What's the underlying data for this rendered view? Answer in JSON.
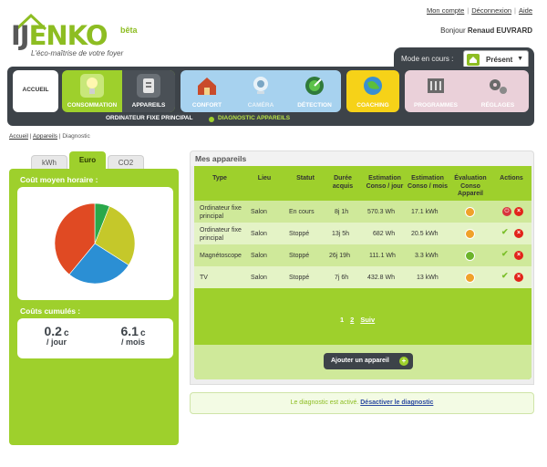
{
  "brand": {
    "name_pre": "IJ",
    "name_post": "ENKO",
    "beta": "bêta",
    "tagline": "L'éco-maîtrise de votre foyer"
  },
  "toplinks": {
    "account": "Mon compte",
    "logout": "Déconnexion",
    "help": "Aide"
  },
  "greeting": {
    "prefix": "Bonjour",
    "user": "Renaud EUVRARD"
  },
  "mode": {
    "label": "Mode en cours :",
    "value": "Présent"
  },
  "nav": {
    "accueil": "ACCUEIL",
    "consommation": "CONSOMMATION",
    "appareils": "APPAREILS",
    "confort": "CONFORT",
    "camera": "CAMÉRA",
    "detection": "DÉTECTION",
    "coaching": "COACHING",
    "programmes": "PROGRAMMES",
    "reglages": "RÉGLAGES"
  },
  "subnav": {
    "item1": "ORDINATEUR FIXE PRINCIPAL",
    "item2": "DIAGNOSTIC APPAREILS"
  },
  "breadcrumb": {
    "home": "Accueil",
    "devices": "Appareils",
    "current": "Diagnostic"
  },
  "left": {
    "tabs": [
      "kWh",
      "Euro",
      "CO2"
    ],
    "hourly_title": "Coût moyen horaire :",
    "cumul_title": "Coûts cumulés :",
    "per_day": {
      "value": "0.2",
      "unit": "c",
      "period": "/ jour"
    },
    "per_month": {
      "value": "6.1",
      "unit": "c",
      "period": "/ mois"
    }
  },
  "pie": {
    "slices": [
      {
        "name": "green",
        "value": 6,
        "color": "#2aa84a"
      },
      {
        "name": "yellow",
        "value": 28,
        "color": "#c5c82a"
      },
      {
        "name": "blue",
        "value": 27,
        "color": "#2b8fd4"
      },
      {
        "name": "red",
        "value": 39,
        "color": "#e04a23"
      }
    ]
  },
  "devices": {
    "title": "Mes appareils",
    "headers": {
      "type": "Type",
      "lieu": "Lieu",
      "statut": "Statut",
      "duree": "Durée acquis",
      "conso_jour": "Estimation Conso / jour",
      "conso_mois": "Estimation Conso / mois",
      "evaluation": "Évaluation Conso Appareil",
      "actions": "Actions"
    },
    "rows": [
      {
        "type": "Ordinateur fixe principal",
        "lieu": "Salon",
        "statut": "En cours",
        "duree": "8j 1h",
        "jour": "570.3 Wh",
        "mois": "17.1 kWh",
        "eval_color": "#f0a12a"
      },
      {
        "type": "Ordinateur fixe principal",
        "lieu": "Salon",
        "statut": "Stoppé",
        "duree": "13j 5h",
        "jour": "682 Wh",
        "mois": "20.5 kWh",
        "eval_color": "#f0a12a"
      },
      {
        "type": "Magnétoscope",
        "lieu": "Salon",
        "statut": "Stoppé",
        "duree": "26j 19h",
        "jour": "111.1 Wh",
        "mois": "3.3 kWh",
        "eval_color": "#6cb42a"
      },
      {
        "type": "TV",
        "lieu": "Salon",
        "statut": "Stoppé",
        "duree": "7j 6h",
        "jour": "432.8 Wh",
        "mois": "13 kWh",
        "eval_color": "#f0a12a"
      }
    ],
    "pager": {
      "p1": "1",
      "p2": "2",
      "next": "Suiv"
    },
    "add_button": "Ajouter un appareil"
  },
  "diagnostic": {
    "text": "Le diagnostic est activé.",
    "link": "Désactiver le diagnostic"
  },
  "colors": {
    "accent_green": "#9ed02c",
    "dark": "#3d4349"
  }
}
